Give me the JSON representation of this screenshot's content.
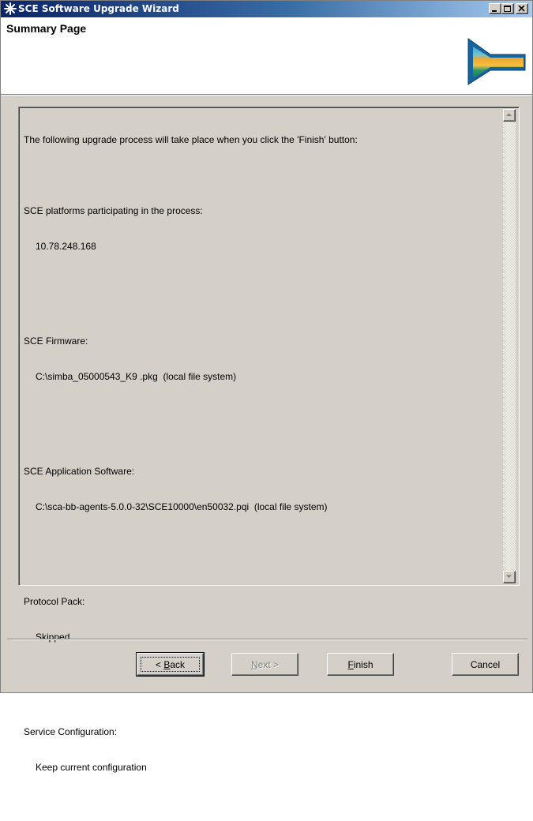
{
  "window": {
    "title": "SCE Software Upgrade Wizard",
    "controls": {
      "minimize_icon": "minimize-icon",
      "maximize_icon": "maximize-icon",
      "close_icon": "close-icon"
    }
  },
  "header": {
    "page_title": "Summary Page",
    "graphic_icon": "wizard-banner-icon"
  },
  "summary": {
    "intro": "The following upgrade process will take place when you click the 'Finish' button:",
    "sections": [
      {
        "label": "SCE platforms participating in the process:",
        "value": "10.78.248.168"
      },
      {
        "label": "SCE Firmware:",
        "value": "C:\\simba_05000543_K9 .pkg  (local file system)"
      },
      {
        "label": "SCE Application Software:",
        "value": "C:\\sca-bb-agents-5.0.0-32\\SCE10000\\en50032.pqi  (local file system)"
      },
      {
        "label": "Protocol Pack:",
        "value": "Skipped"
      },
      {
        "label": "Service Configuration:",
        "value": "Keep current configuration"
      }
    ]
  },
  "buttons": {
    "back_pre": "< ",
    "back_key": "B",
    "back_post": "ack",
    "next_key": "N",
    "next_post": "ext >",
    "finish_key": "F",
    "finish_post": "inish",
    "cancel": "Cancel"
  },
  "colors": {
    "titlebar_start": "#0a246a",
    "titlebar_end": "#a6caf0",
    "dialog_bg": "#d4d0c8"
  }
}
